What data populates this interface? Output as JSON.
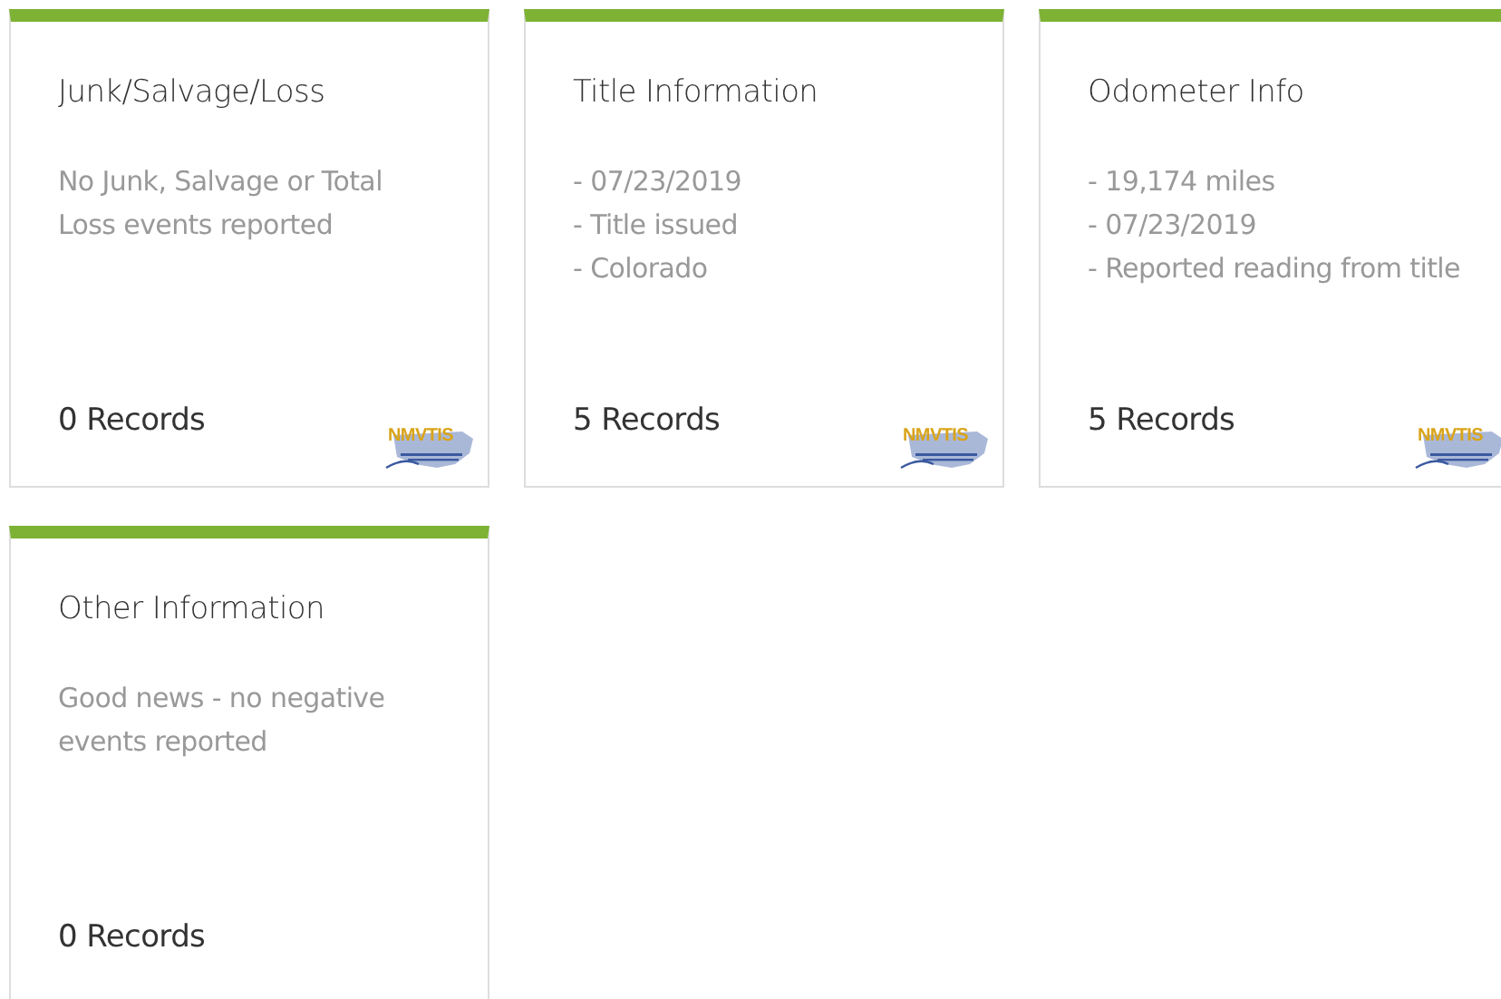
{
  "cards": [
    {
      "title": "Junk/Salvage/Loss",
      "lines": [
        "No Junk, Salvage or Total Loss events reported"
      ],
      "records": "0 Records",
      "logo": {
        "text": "NMVTIS"
      }
    },
    {
      "title": "Title Information",
      "lines": [
        "- 07/23/2019",
        "- Title issued",
        "- Colorado"
      ],
      "records": "5 Records",
      "logo": {
        "text": "NMVTIS"
      }
    },
    {
      "title": "Odometer Info",
      "lines": [
        "- 19,174 miles",
        "- 07/23/2019",
        "- Reported reading from title"
      ],
      "records": "5 Records",
      "logo": {
        "text": "NMVTIS"
      }
    },
    {
      "title": "Other Information",
      "lines": [
        "Good news - no negative events reported"
      ],
      "records": "0 Records"
    }
  ]
}
